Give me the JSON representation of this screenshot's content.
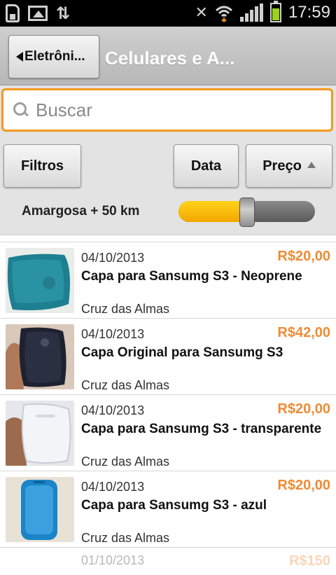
{
  "status_bar": {
    "time": "17:59",
    "icons": [
      "sim-icon",
      "gallery-icon",
      "sync-icon",
      "mute-icon",
      "wifi-icon",
      "signal-icon",
      "battery-icon"
    ],
    "battery_color": "#9ad31a"
  },
  "header": {
    "back_label": "Eletrôni...",
    "title": "Celulares e A...",
    "background": "#c4c4c4"
  },
  "search": {
    "placeholder": "Buscar",
    "value": "",
    "border_color": "#f39a1e"
  },
  "filters": {
    "filtros_label": "Filtros",
    "data_label": "Data",
    "preco_label": "Preço",
    "sort_direction": "ascending",
    "distance_label": "Amargosa + 50 km",
    "distance_slider_fraction": 0.5,
    "slider_color": "#f2a700"
  },
  "listings": [
    {
      "date": "04/10/2013",
      "price": "R$20,00",
      "title": "Capa para Sansumg S3 - Neoprene",
      "city": "Cruz das Almas",
      "image": "teal-neoprene-case"
    },
    {
      "date": "04/10/2013",
      "price": "R$42,00",
      "title": "Capa Original para Sansumg S3",
      "city": "Cruz das Almas",
      "image": "black-case-in-hand"
    },
    {
      "date": "04/10/2013",
      "price": "R$20,00",
      "title": "Capa para Sansumg S3 - transparente",
      "city": "Cruz das Almas",
      "image": "transparent-case-in-hand"
    },
    {
      "date": "04/10/2013",
      "price": "R$20,00",
      "title": "Capa para Sansumg S3 - azul",
      "city": "Cruz das Almas",
      "image": "blue-case"
    },
    {
      "date": "01/10/2013",
      "price": "R$150",
      "title": "",
      "city": "",
      "image": ""
    }
  ],
  "colors": {
    "price": "#ef8b33",
    "accent": "#f39a1e"
  }
}
